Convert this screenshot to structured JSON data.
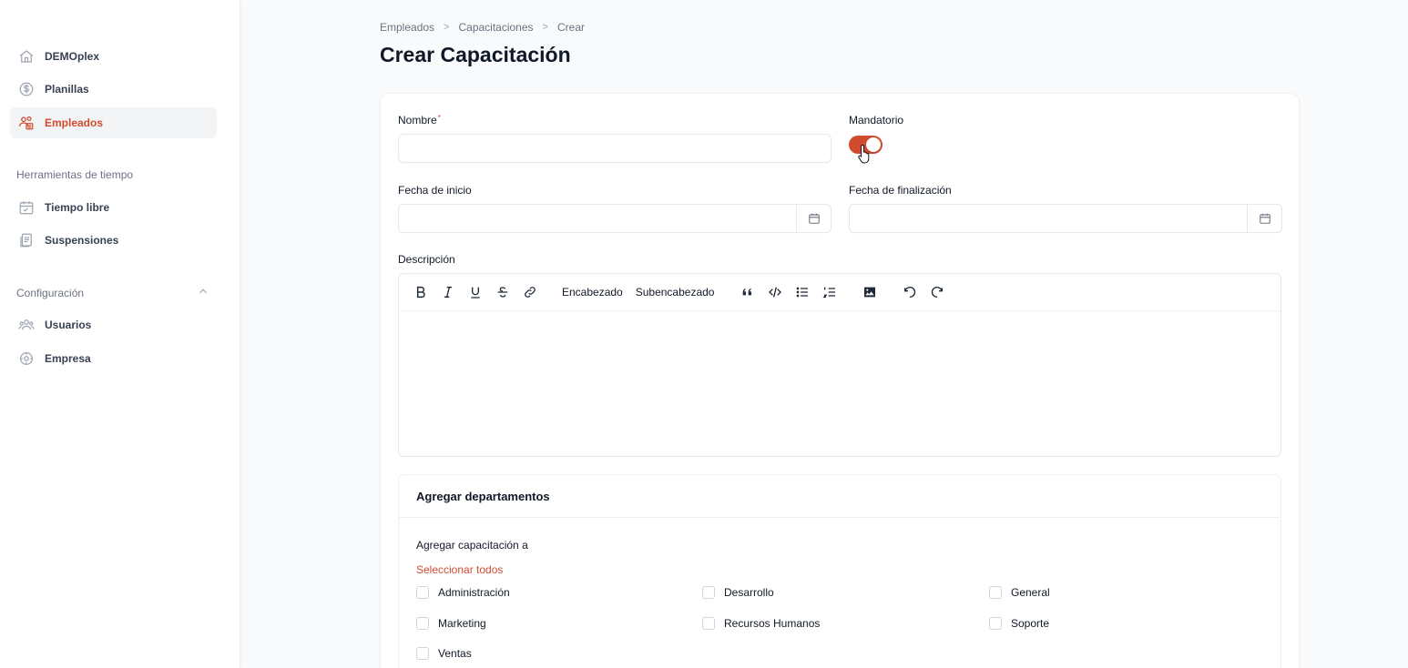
{
  "sidebar": {
    "items": [
      {
        "label": "DEMOplex",
        "icon": "home-icon"
      },
      {
        "label": "Planillas",
        "icon": "dollar-circle-icon"
      },
      {
        "label": "Empleados",
        "icon": "users-icon",
        "active": true
      }
    ],
    "groups": [
      {
        "title": "Herramientas de tiempo",
        "items": [
          {
            "label": "Tiempo libre",
            "icon": "calendar-icon"
          },
          {
            "label": "Suspensiones",
            "icon": "document-icon"
          }
        ]
      },
      {
        "title": "Configuración",
        "items": [
          {
            "label": "Usuarios",
            "icon": "user-group-icon"
          },
          {
            "label": "Empresa",
            "icon": "gear-icon"
          }
        ]
      }
    ]
  },
  "breadcrumb": [
    "Empleados",
    "Capacitaciones",
    "Crear"
  ],
  "page_title": "Crear Capacitación",
  "form": {
    "nombre_label": "Nombre",
    "nombre_required": "*",
    "nombre_value": "",
    "mandatorio_label": "Mandatorio",
    "mandatorio_on": true,
    "fecha_inicio_label": "Fecha de inicio",
    "fecha_fin_label": "Fecha de finalización",
    "descripcion_label": "Descripción",
    "toolbar": {
      "heading": "Encabezado",
      "subheading": "Subencabezado"
    }
  },
  "departments": {
    "title": "Agregar departamentos",
    "subtitle": "Agregar capacitación a",
    "select_all": "Seleccionar todos",
    "items": [
      "Administración",
      "Desarrollo",
      "General",
      "Marketing",
      "Recursos Humanos",
      "Soporte",
      "Ventas"
    ]
  },
  "colors": {
    "accent": "#d14b2f",
    "background": "#f9fafb"
  }
}
